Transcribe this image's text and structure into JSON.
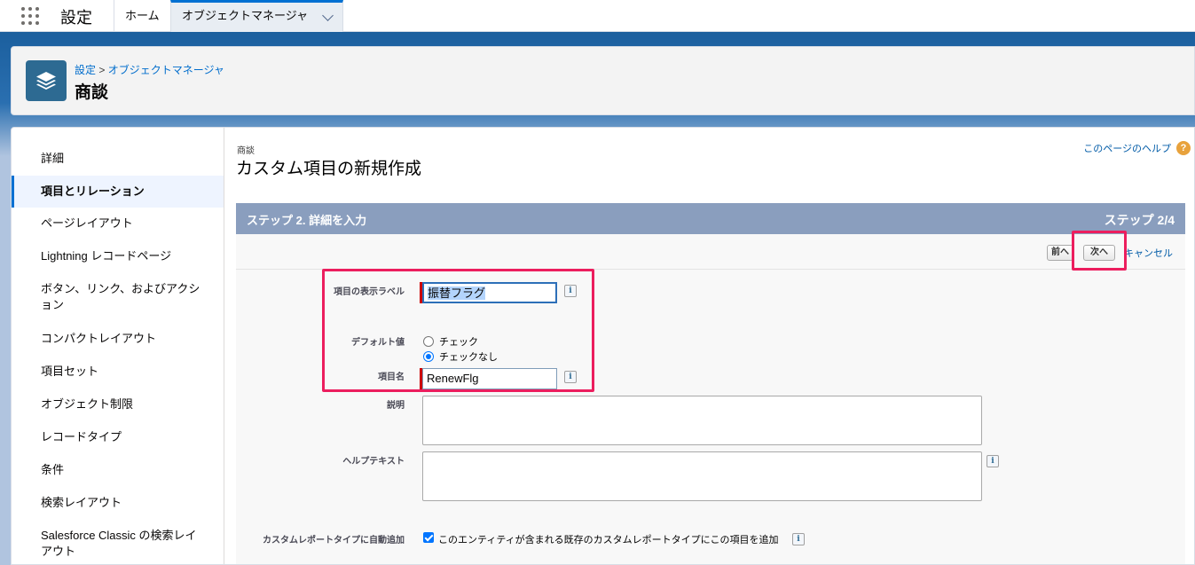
{
  "topnav": {
    "app_name": "設定",
    "tabs": [
      {
        "label": "ホーム"
      },
      {
        "label": "オブジェクトマネージャ"
      }
    ]
  },
  "header": {
    "breadcrumb_root": "設定",
    "breadcrumb_sep": " > ",
    "breadcrumb_current": "オブジェクトマネージャ",
    "title": "商談",
    "icon": "layers-icon"
  },
  "sidebar": {
    "items": [
      {
        "label": "詳細"
      },
      {
        "label": "項目とリレーション",
        "active": true
      },
      {
        "label": "ページレイアウト"
      },
      {
        "label": "Lightning レコードページ"
      },
      {
        "label": "ボタン、リンク、およびアクション"
      },
      {
        "label": "コンパクトレイアウト"
      },
      {
        "label": "項目セット"
      },
      {
        "label": "オブジェクト制限"
      },
      {
        "label": "レコードタイプ"
      },
      {
        "label": "条件"
      },
      {
        "label": "検索レイアウト"
      },
      {
        "label": "Salesforce Classic の検索レイアウト"
      }
    ]
  },
  "content": {
    "object_label": "商談",
    "title": "カスタム項目の新規作成",
    "help_link": "このページのヘルプ",
    "step_label": "ステップ 2. 詳細を入力",
    "step_count": "ステップ 2/4",
    "buttons": {
      "prev": "前へ",
      "next": "次へ",
      "cancel": "キャンセル"
    },
    "fields": {
      "display_label": {
        "label": "項目の表示ラベル",
        "value": "振替フラグ"
      },
      "default_value": {
        "label": "デフォルト値",
        "options": [
          {
            "label": "チェック",
            "checked": false
          },
          {
            "label": "チェックなし",
            "checked": true
          }
        ]
      },
      "field_name": {
        "label": "項目名",
        "value": "RenewFlg"
      },
      "description": {
        "label": "説明",
        "value": ""
      },
      "help_text": {
        "label": "ヘルプテキスト",
        "value": ""
      },
      "auto_add": {
        "label": "カスタムレポートタイプに自動追加",
        "text": "このエンティティが含まれる既存のカスタムレポートタイプにこの項目を追加",
        "checked": true
      }
    },
    "info_glyph": "i"
  },
  "colors": {
    "highlight": "#ec1e5e",
    "step_bar": "#8a9ebe",
    "link": "#015ba7",
    "brand_blue": "#1b5f9e"
  }
}
